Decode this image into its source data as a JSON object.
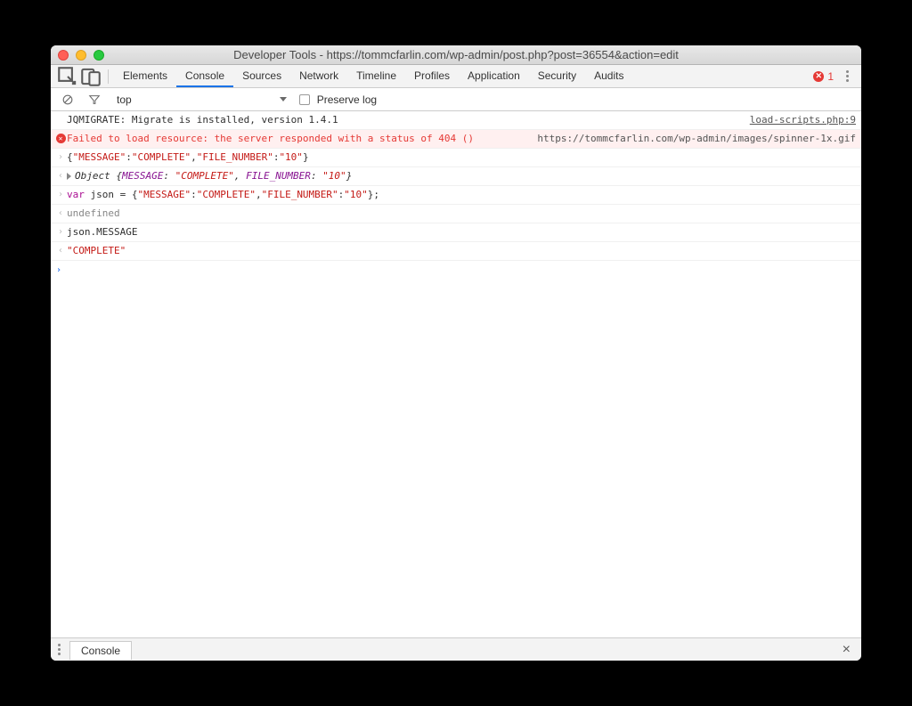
{
  "window": {
    "title": "Developer Tools - https://tommcfarlin.com/wp-admin/post.php?post=36554&action=edit"
  },
  "tabs": {
    "items": [
      "Elements",
      "Console",
      "Sources",
      "Network",
      "Timeline",
      "Profiles",
      "Application",
      "Security",
      "Audits"
    ],
    "active": "Console"
  },
  "error_badge": {
    "count": "1"
  },
  "filter": {
    "context": "top",
    "preserve_label": "Preserve log"
  },
  "rows": [
    {
      "type": "info",
      "gutter": "",
      "text": "JQMIGRATE: Migrate is installed, version 1.4.1",
      "link": "load-scripts.php:9"
    },
    {
      "type": "error",
      "text": "Failed to load resource: the server responded with a status of 404 ()",
      "link": "https://tommcfarlin.com/wp-admin/images/spinner-1x.gif"
    },
    {
      "type": "input",
      "segments": [
        {
          "t": "{"
        },
        {
          "t": "\"MESSAGE\"",
          "c": "str"
        },
        {
          "t": ":"
        },
        {
          "t": "\"COMPLETE\"",
          "c": "str"
        },
        {
          "t": ","
        },
        {
          "t": "\"FILE_NUMBER\"",
          "c": "str"
        },
        {
          "t": ":"
        },
        {
          "t": "\"10\"",
          "c": "str"
        },
        {
          "t": "}"
        }
      ]
    },
    {
      "type": "output-obj",
      "segments": [
        {
          "t": "Object {",
          "c": "obj"
        },
        {
          "t": "MESSAGE",
          "c": "key"
        },
        {
          "t": ": ",
          "c": "obj"
        },
        {
          "t": "\"COMPLETE\"",
          "c": "val"
        },
        {
          "t": ", ",
          "c": "obj"
        },
        {
          "t": "FILE_NUMBER",
          "c": "key"
        },
        {
          "t": ": ",
          "c": "obj"
        },
        {
          "t": "\"10\"",
          "c": "val"
        },
        {
          "t": "}",
          "c": "obj"
        }
      ]
    },
    {
      "type": "input",
      "segments": [
        {
          "t": "var ",
          "c": "kw"
        },
        {
          "t": "json = {"
        },
        {
          "t": "\"MESSAGE\"",
          "c": "str"
        },
        {
          "t": ":"
        },
        {
          "t": "\"COMPLETE\"",
          "c": "str"
        },
        {
          "t": ","
        },
        {
          "t": "\"FILE_NUMBER\"",
          "c": "str"
        },
        {
          "t": ":"
        },
        {
          "t": "\"10\"",
          "c": "str"
        },
        {
          "t": "};"
        }
      ]
    },
    {
      "type": "output-undef",
      "text": "undefined"
    },
    {
      "type": "input",
      "segments": [
        {
          "t": "json.MESSAGE"
        }
      ]
    },
    {
      "type": "output-str",
      "segments": [
        {
          "t": "\"COMPLETE\"",
          "c": "str"
        }
      ]
    }
  ],
  "drawer": {
    "tab": "Console"
  }
}
